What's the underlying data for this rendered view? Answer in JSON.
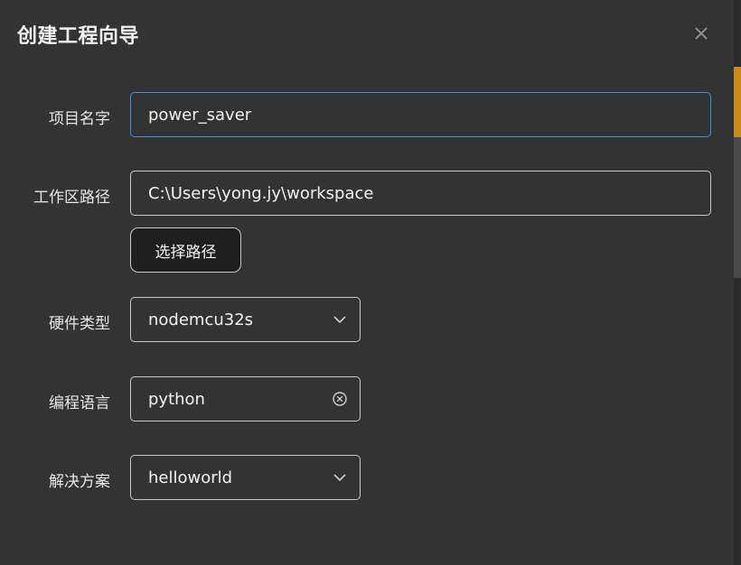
{
  "dialog": {
    "title": "创建工程向导",
    "close_icon": "close-icon"
  },
  "form": {
    "project_name": {
      "label": "项目名字",
      "value": "power_saver"
    },
    "workspace_path": {
      "label": "工作区路径",
      "value": "C:\\Users\\yong.jy\\workspace",
      "browse_label": "选择路径"
    },
    "hardware_type": {
      "label": "硬件类型",
      "value": "nodemcu32s",
      "icon": "chevron-down-icon"
    },
    "language": {
      "label": "编程语言",
      "value": "python",
      "icon": "clear-circle-icon"
    },
    "solution": {
      "label": "解决方案",
      "value": "helloworld",
      "icon": "chevron-down-icon"
    }
  },
  "colors": {
    "background": "#333333",
    "focus_border": "#4a8fd8",
    "side_accent": "#c88a1a"
  }
}
